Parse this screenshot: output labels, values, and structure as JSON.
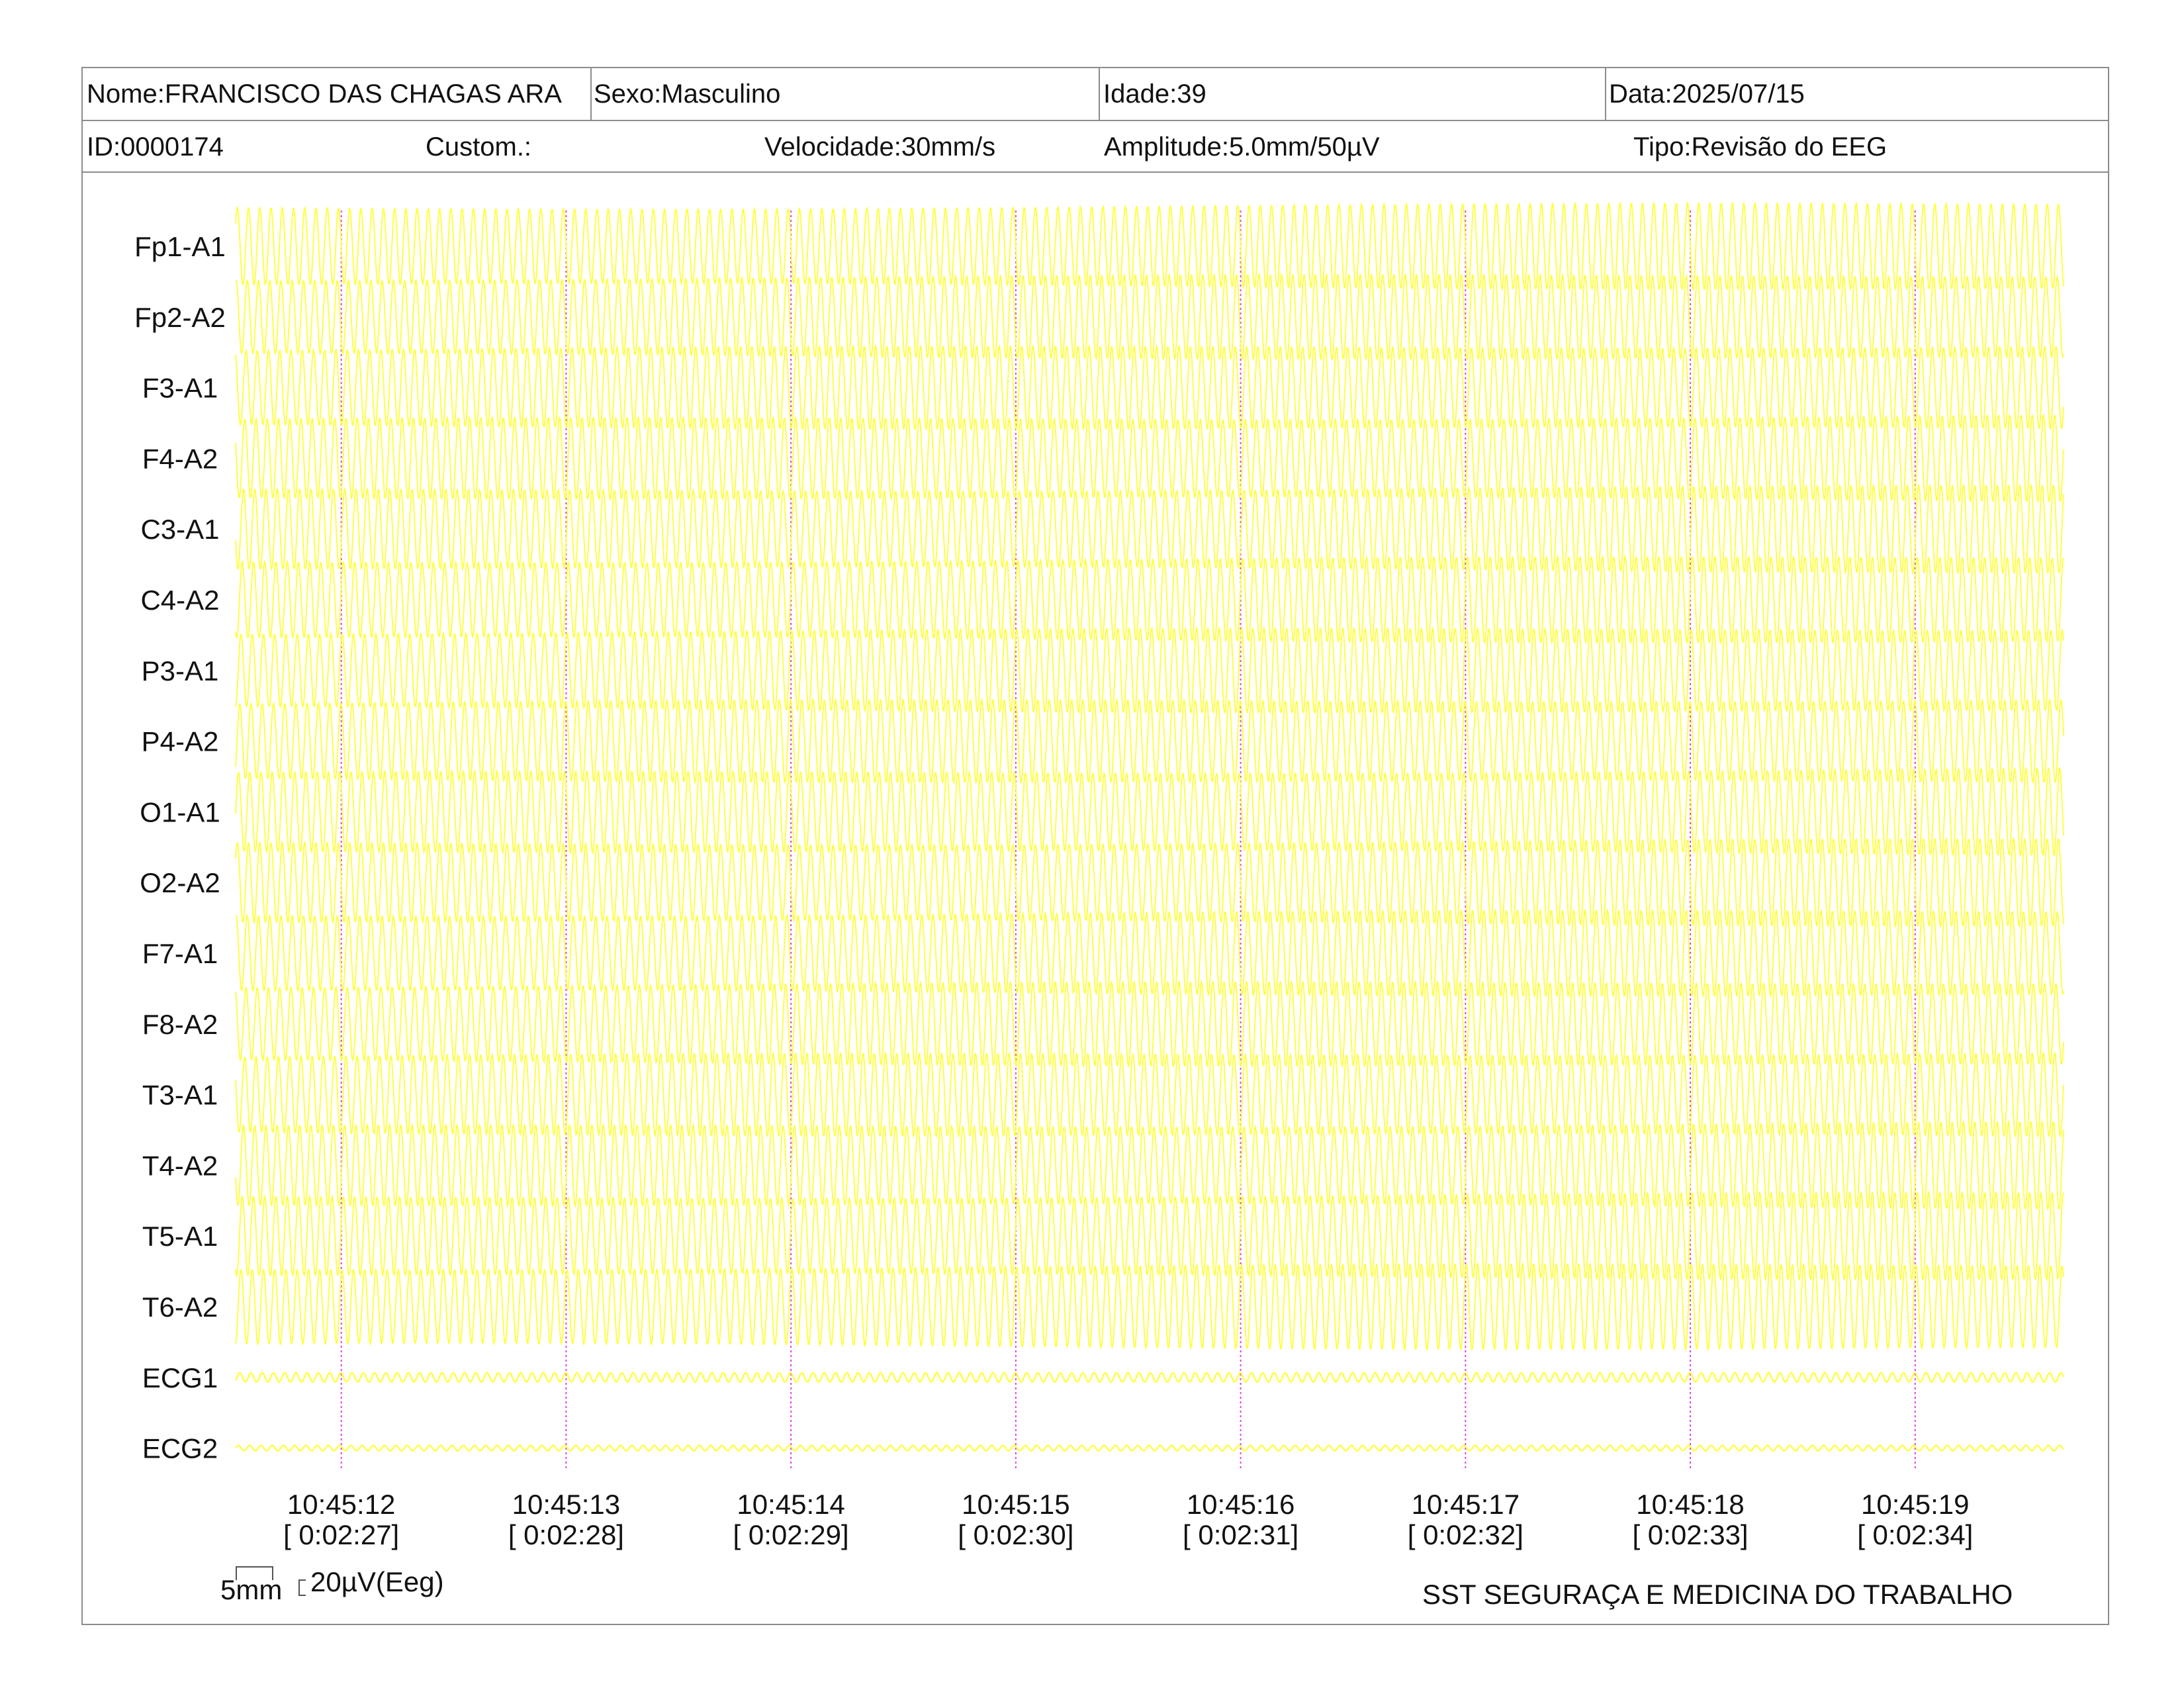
{
  "header": {
    "name": "Nome:FRANCISCO DAS CHAGAS ARA",
    "sex": "Sexo:Masculino",
    "age": "Idade:39",
    "date": "Data:2025/07/15",
    "id": "ID:0000174",
    "custom": "Custom.:",
    "speed": "Velocidade:30mm/s",
    "amplitude": "Amplitude:5.0mm/50µV",
    "type": "Tipo:Revisão do EEG"
  },
  "chart_data": {
    "type": "line",
    "title": "",
    "trace_color": "#ffff33",
    "marker_color": "#e040e0",
    "channels": [
      {
        "name": "Fp1-A1",
        "kind": "eeg"
      },
      {
        "name": "Fp2-A2",
        "kind": "eeg"
      },
      {
        "name": "F3-A1",
        "kind": "eeg"
      },
      {
        "name": "F4-A2",
        "kind": "eeg"
      },
      {
        "name": "C3-A1",
        "kind": "eeg"
      },
      {
        "name": "C4-A2",
        "kind": "eeg"
      },
      {
        "name": "P3-A1",
        "kind": "eeg"
      },
      {
        "name": "P4-A2",
        "kind": "eeg"
      },
      {
        "name": "O1-A1",
        "kind": "eeg"
      },
      {
        "name": "O2-A2",
        "kind": "eeg"
      },
      {
        "name": "F7-A1",
        "kind": "eeg"
      },
      {
        "name": "F8-A2",
        "kind": "eeg"
      },
      {
        "name": "T3-A1",
        "kind": "eeg"
      },
      {
        "name": "T4-A2",
        "kind": "eeg"
      },
      {
        "name": "T5-A1",
        "kind": "eeg"
      },
      {
        "name": "T6-A2",
        "kind": "eeg"
      },
      {
        "name": "ECG1",
        "kind": "ecg"
      },
      {
        "name": "ECG2",
        "kind": "ecg"
      }
    ],
    "time_markers": [
      {
        "time": "10:45:12",
        "elapsed": "[ 0:02:27]"
      },
      {
        "time": "10:45:13",
        "elapsed": "[ 0:02:28]"
      },
      {
        "time": "10:45:14",
        "elapsed": "[ 0:02:29]"
      },
      {
        "time": "10:45:15",
        "elapsed": "[ 0:02:30]"
      },
      {
        "time": "10:45:16",
        "elapsed": "[ 0:02:31]"
      },
      {
        "time": "10:45:17",
        "elapsed": "[ 0:02:32]"
      },
      {
        "time": "10:45:18",
        "elapsed": "[ 0:02:33]"
      },
      {
        "time": "10:45:19",
        "elapsed": "[ 0:02:34]"
      }
    ],
    "time_range_s": [
      11.53,
      19.66
    ],
    "signal_frequency_hz": 20
  },
  "scale": {
    "time_label": "5mm",
    "amp_label": "20µV(Eeg)"
  },
  "footer": {
    "company": "SST SEGURAÇA E MEDICINA DO TRABALHO"
  }
}
